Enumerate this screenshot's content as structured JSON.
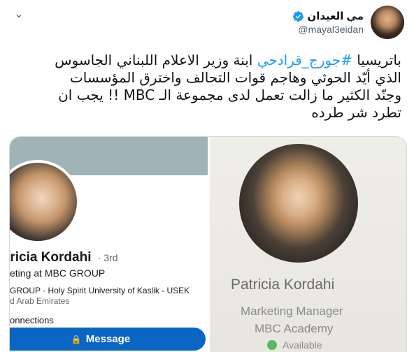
{
  "tweet": {
    "author": {
      "display_name": "مي العيدان",
      "handle": "@mayal3eidan",
      "verified": true
    },
    "text_before_hashtag": "باتريسيا ",
    "hashtag": "#جورج_قرادحي",
    "text_after_hashtag": " ابنة وزير الاعلام اللبناني الجاسوس\nالذي أيّد الحوثي وهاجم قوات التحالف واخترق المؤسسات\nوجنّد الكثير ما زالت تعمل لدى مجموعة الـ MBC !! يجب ان\nتطرد شر طرده",
    "more_icon": "chevron-down-icon",
    "verified_icon": "verified-badge-icon"
  },
  "media": {
    "linkedin_card": {
      "name": "tricia Kordahi",
      "degree": "· 3rd",
      "headline": "eting at MBC GROUP",
      "education": "GROUP · Holy Spirit University of Kaslik - USEK",
      "location": "d Arab Emirates",
      "connections": "onnections",
      "message_button": "Message",
      "lock_icon": "lock-icon",
      "accent_color": "#0a66c2"
    },
    "profile_card": {
      "name": "Patricia Kordahi",
      "title": "Marketing Manager",
      "organization": "MBC Academy",
      "status": "Available",
      "status_color": "#5fb85f"
    }
  }
}
